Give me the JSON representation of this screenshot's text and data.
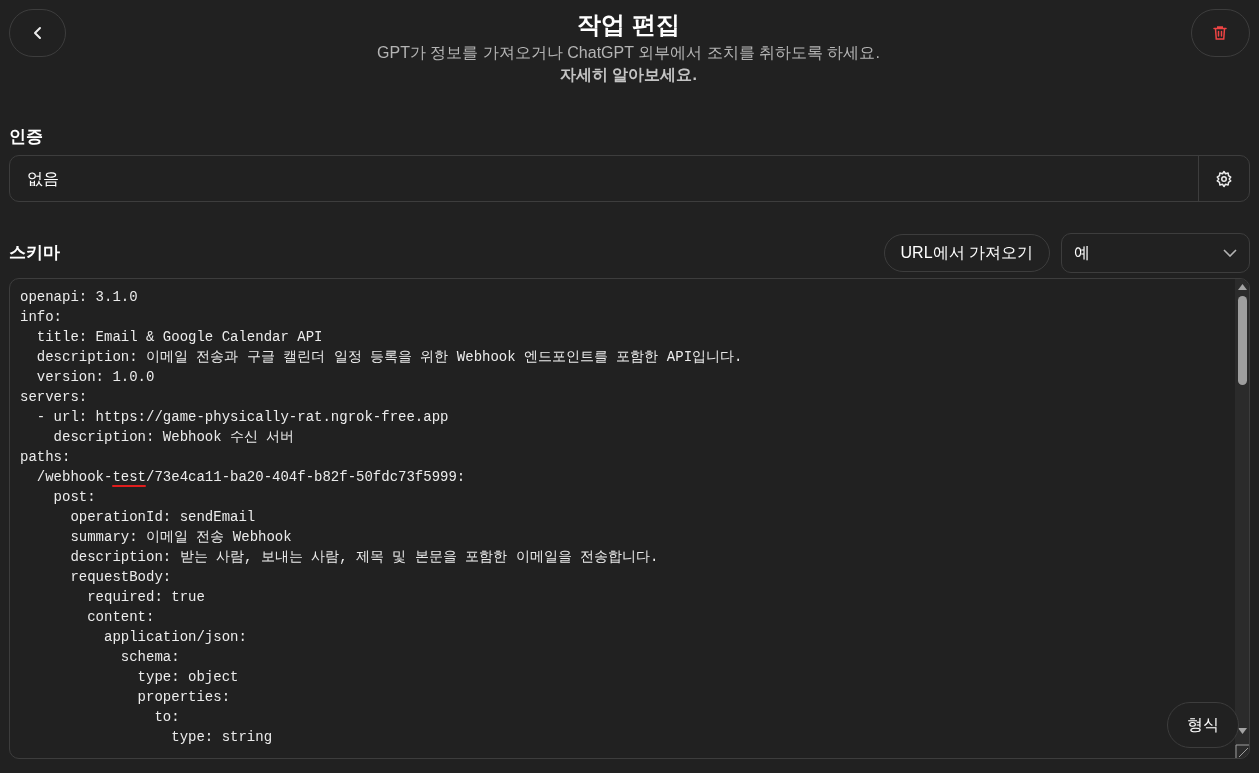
{
  "header": {
    "title": "작업 편집",
    "subtitle": "GPT가 정보를 가져오거나 ChatGPT 외부에서 조치를 취하도록 하세요.",
    "learn_more": "자세히 알아보세요."
  },
  "authentication": {
    "label": "인증",
    "value": "없음"
  },
  "schema": {
    "label": "스키마",
    "import_button": "URL에서 가져오기",
    "select_value": "예",
    "format_button": "형식",
    "lines": [
      "openapi: 3.1.0",
      "info:",
      "  title: Email & Google Calendar API",
      "  description: 이메일 전송과 구글 캘린더 일정 등록을 위한 Webhook 엔드포인트를 포함한 API입니다.",
      "  version: 1.0.0",
      "servers:",
      "  - url: https://game-physically-rat.ngrok-free.app",
      "    description: Webhook 수신 서버",
      "paths:",
      "  /webhook-test/73e4ca11-ba20-404f-b82f-50fdc73f5999:",
      "    post:",
      "      operationId: sendEmail",
      "      summary: 이메일 전송 Webhook",
      "      description: 받는 사람, 보내는 사람, 제목 및 본문을 포함한 이메일을 전송합니다.",
      "      requestBody:",
      "        required: true",
      "        content:",
      "          application/json:",
      "            schema:",
      "              type: object",
      "              properties:",
      "                to:",
      "                  type: string"
    ]
  }
}
